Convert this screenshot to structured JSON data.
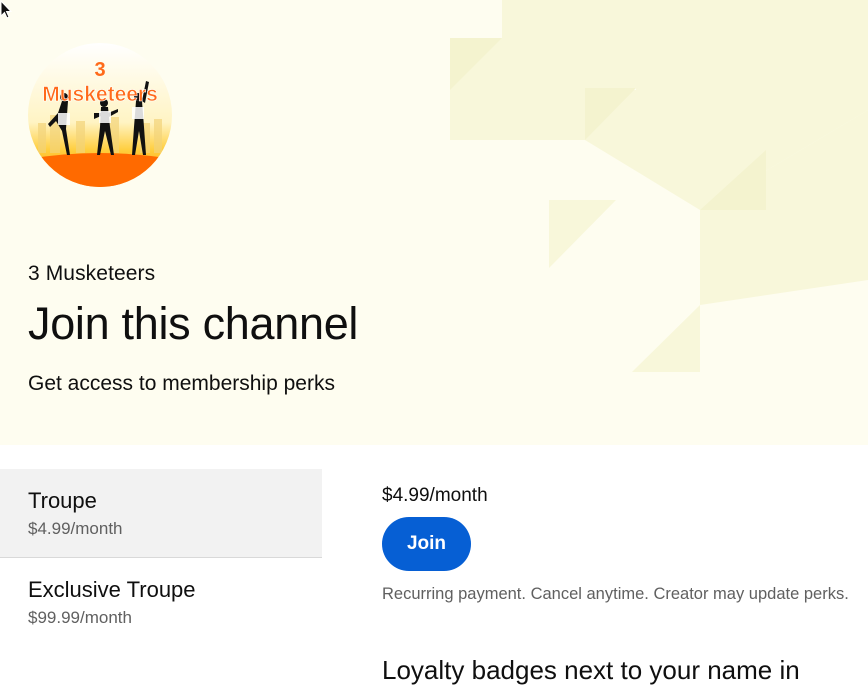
{
  "channel": {
    "name": "3 Musketeers",
    "avatar_text_top": "3",
    "avatar_text_bottom": "Musketeers"
  },
  "hero": {
    "title": "Join this channel",
    "subtitle": "Get access to membership perks"
  },
  "tiers": [
    {
      "name": "Troupe",
      "price": "$4.99/month",
      "selected": true
    },
    {
      "name": "Exclusive Troupe",
      "price": "$99.99/month",
      "selected": false
    }
  ],
  "selected_tier": {
    "price": "$4.99/month",
    "join_label": "Join",
    "recurring_note": "Recurring payment. Cancel anytime. Creator may update perks.",
    "partial_text": "Loyalty badges next to your name in"
  },
  "colors": {
    "hero_bg": "#fefdf0",
    "accent": "#065fd4",
    "selected_tier_bg": "#f2f2f2"
  },
  "icons": {
    "cursor": "mouse-pointer-icon"
  }
}
